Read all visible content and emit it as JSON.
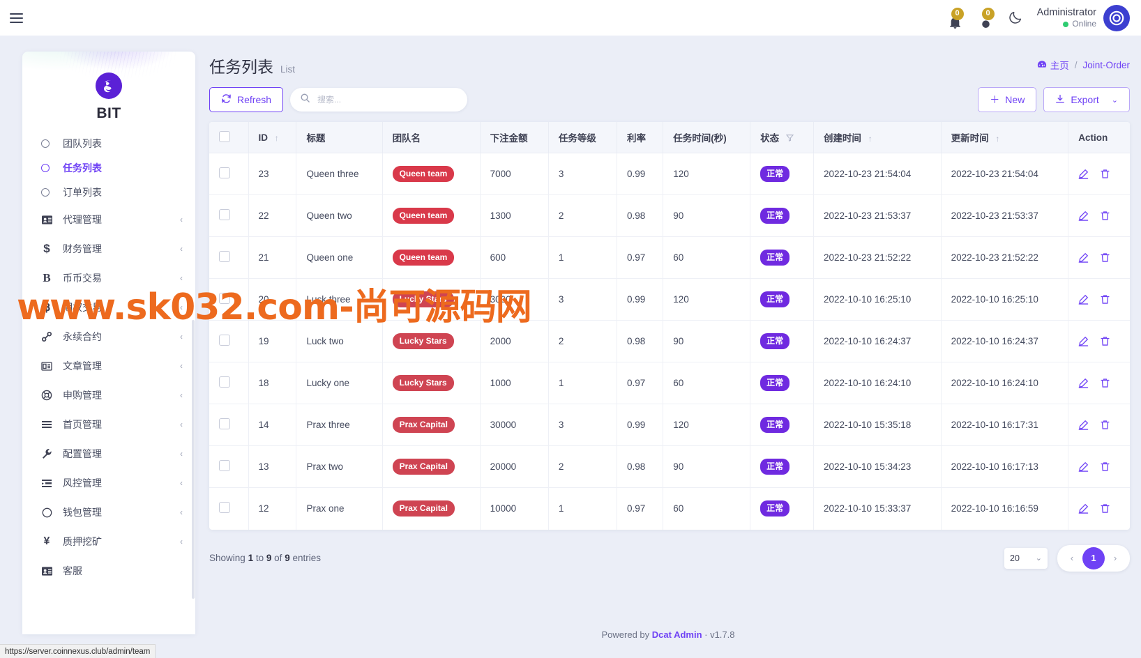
{
  "topbar": {
    "menu_toggle": "hamburger-menu",
    "notifications_count": "0",
    "messages_count": "0",
    "theme_toggle": "moon-icon",
    "user_name": "Administrator",
    "user_status": "Online"
  },
  "sidebar": {
    "brand_name": "BIT",
    "sub_items": [
      {
        "label": "团队列表",
        "active": false
      },
      {
        "label": "任务列表",
        "active": true
      },
      {
        "label": "订单列表",
        "active": false
      }
    ],
    "items": [
      {
        "label": "代理管理",
        "icon": "id-card-icon",
        "caret": "‹"
      },
      {
        "label": "财务管理",
        "icon": "dollar-icon",
        "caret": "‹"
      },
      {
        "label": "币币交易",
        "icon": "bitcoin-b-icon",
        "caret": "‹"
      },
      {
        "label": "期权交易",
        "icon": "bitcoin-icon",
        "caret": "‹"
      },
      {
        "label": "永续合约",
        "icon": "link-icon",
        "caret": "‹"
      },
      {
        "label": "文章管理",
        "icon": "newspaper-icon",
        "caret": "‹"
      },
      {
        "label": "申购管理",
        "icon": "lifebuoy-icon",
        "caret": "‹"
      },
      {
        "label": "首页管理",
        "icon": "bars-icon",
        "caret": "‹"
      },
      {
        "label": "配置管理",
        "icon": "wrench-icon",
        "caret": "‹"
      },
      {
        "label": "风控管理",
        "icon": "indent-icon",
        "caret": "‹"
      },
      {
        "label": "钱包管理",
        "icon": "circle-icon",
        "caret": "‹"
      },
      {
        "label": "质押挖矿",
        "icon": "yen-icon",
        "caret": "‹"
      },
      {
        "label": "客服",
        "icon": "id-card-icon",
        "caret": ""
      }
    ]
  },
  "page": {
    "title": "任务列表",
    "subtitle": "List",
    "breadcrumb_home": "主页",
    "breadcrumb_sep": "/",
    "breadcrumb_current": "Joint-Order"
  },
  "toolbar": {
    "refresh_label": "Refresh",
    "search_placeholder": "搜索...",
    "search_value": "",
    "new_label": "New",
    "export_label": "Export"
  },
  "table": {
    "columns": [
      "",
      "ID",
      "标题",
      "团队名",
      "下注金额",
      "任务等级",
      "利率",
      "任务时间(秒)",
      "状态",
      "创建时间",
      "更新时间",
      "Action"
    ],
    "sortable": [
      "ID",
      "创建时间",
      "更新时间"
    ],
    "filterable": [
      "状态"
    ],
    "rows": [
      {
        "id": "23",
        "title": "Queen three",
        "team": "Queen team",
        "team_color": "#d9394a",
        "amount": "7000",
        "level": "3",
        "rate": "0.99",
        "duration": "120",
        "status": "正常",
        "created": "2022-10-23 21:54:04",
        "updated": "2022-10-23 21:54:04"
      },
      {
        "id": "22",
        "title": "Queen two",
        "team": "Queen team",
        "team_color": "#d9394a",
        "amount": "1300",
        "level": "2",
        "rate": "0.98",
        "duration": "90",
        "status": "正常",
        "created": "2022-10-23 21:53:37",
        "updated": "2022-10-23 21:53:37"
      },
      {
        "id": "21",
        "title": "Queen one",
        "team": "Queen team",
        "team_color": "#d9394a",
        "amount": "600",
        "level": "1",
        "rate": "0.97",
        "duration": "60",
        "status": "正常",
        "created": "2022-10-23 21:52:22",
        "updated": "2022-10-23 21:52:22"
      },
      {
        "id": "20",
        "title": "Luck three",
        "team": "Lucky Stars",
        "team_color": "#cf4452",
        "amount": "3000",
        "level": "3",
        "rate": "0.99",
        "duration": "120",
        "status": "正常",
        "created": "2022-10-10 16:25:10",
        "updated": "2022-10-10 16:25:10"
      },
      {
        "id": "19",
        "title": "Luck two",
        "team": "Lucky Stars",
        "team_color": "#cf4452",
        "amount": "2000",
        "level": "2",
        "rate": "0.98",
        "duration": "90",
        "status": "正常",
        "created": "2022-10-10 16:24:37",
        "updated": "2022-10-10 16:24:37"
      },
      {
        "id": "18",
        "title": "Lucky one",
        "team": "Lucky Stars",
        "team_color": "#cf4452",
        "amount": "1000",
        "level": "1",
        "rate": "0.97",
        "duration": "60",
        "status": "正常",
        "created": "2022-10-10 16:24:10",
        "updated": "2022-10-10 16:24:10"
      },
      {
        "id": "14",
        "title": "Prax three",
        "team": "Prax Capital",
        "team_color": "#cf4452",
        "amount": "30000",
        "level": "3",
        "rate": "0.99",
        "duration": "120",
        "status": "正常",
        "created": "2022-10-10 15:35:18",
        "updated": "2022-10-10 16:17:31"
      },
      {
        "id": "13",
        "title": "Prax two",
        "team": "Prax Capital",
        "team_color": "#cf4452",
        "amount": "20000",
        "level": "2",
        "rate": "0.98",
        "duration": "90",
        "status": "正常",
        "created": "2022-10-10 15:34:23",
        "updated": "2022-10-10 16:17:13"
      },
      {
        "id": "12",
        "title": "Prax one",
        "team": "Prax Capital",
        "team_color": "#cf4452",
        "amount": "10000",
        "level": "1",
        "rate": "0.97",
        "duration": "60",
        "status": "正常",
        "created": "2022-10-10 15:33:37",
        "updated": "2022-10-10 16:16:59"
      }
    ]
  },
  "tablefoot": {
    "showing_prefix": "Showing",
    "showing_from": "1",
    "showing_to_word": "to",
    "showing_to": "9",
    "showing_of_word": "of",
    "showing_total": "9",
    "showing_suffix": "entries",
    "per_page": "20",
    "current_page": "1"
  },
  "footer": {
    "powered_prefix": "Powered by",
    "powered_name": "Dcat Admin",
    "version": "v1.7.8"
  },
  "status_url": "https://server.coinnexus.club/admin/team",
  "watermark": "www.sk032.com-尚可源码网",
  "colors": {
    "accent": "#6f42f5",
    "status_badge": "#6f2ae0",
    "tag_red": "#d9394a",
    "badge_gold": "#c9a227",
    "page_bg": "#ebeef7",
    "watermark": "#ed6a1e"
  }
}
